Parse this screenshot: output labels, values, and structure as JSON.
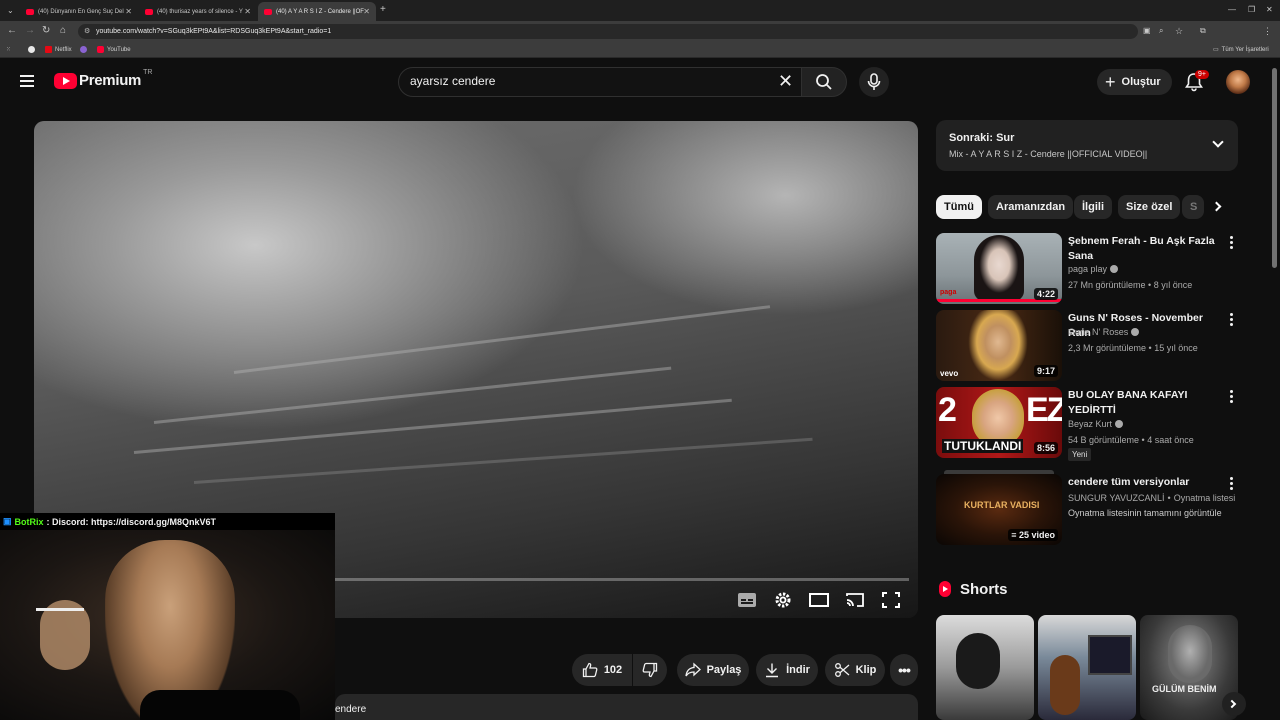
{
  "browser": {
    "tabs": [
      {
        "title": "(40) Dünyanın En Genç Suç Del"
      },
      {
        "title": "(40) thurisaz years of silence - Y"
      },
      {
        "title": "(40) A Y A R S I Z - Cendere ||OF"
      }
    ],
    "url": "youtube.com/watch?v=SGuq3kEPt9A&list=RDSGuq3kEPt9A&start_radio=1",
    "bookmarks": [
      "Netflix",
      "YouTube"
    ],
    "all_bookmarks": "Tüm Yer İşaretleri"
  },
  "header": {
    "brand": "Premium",
    "region": "TR",
    "search_value": "ayarsız cendere",
    "create_label": "Oluştur",
    "notif_count": "9+"
  },
  "stream": {
    "bot_name": "BotRix",
    "bot_message": ": Discord: https://discord.gg/M8QnkV6T"
  },
  "actions": {
    "like_count": "102",
    "share": "Paylaş",
    "download": "İndir",
    "clip": "Klip"
  },
  "description": {
    "text": "endere"
  },
  "upnext": {
    "title": "Sonraki: Sur",
    "subtitle": "Mix - A Y A R S I Z - Cendere ||OFFICIAL VIDEO||"
  },
  "chips": [
    "Tümü",
    "Aramanızdan",
    "İlgili",
    "Size özel",
    "S"
  ],
  "recommendations": [
    {
      "title": "Şebnem Ferah - Bu Aşk Fazla Sana",
      "channel": "paga play",
      "views": "27 Mn görüntüleme",
      "age": "8 yıl önce",
      "duration": "4:22"
    },
    {
      "title": "Guns N' Roses - November Rain",
      "channel": "Guns N' Roses",
      "views": "2,3 Mr görüntüleme",
      "age": "15 yıl önce",
      "duration": "9:17"
    },
    {
      "title": "BU OLAY BANA KAFAYI YEDİRTTİ",
      "channel": "Beyaz Kurt",
      "views": "54 B görüntüleme",
      "age": "4 saat önce",
      "duration": "8:56",
      "badge": "Yeni"
    },
    {
      "title": "cendere tüm versiyonlar",
      "channel": "SUNGUR YAVUZCANLİ",
      "channel_suffix": "Oynatma listesi",
      "meta": "Oynatma listesinin tamamını görüntüle",
      "duration": "25 video"
    }
  ],
  "thumb_text": {
    "paga": "paga",
    "vevo": "vevo",
    "tutuklandi": "TUTUKLANDI",
    "kurtlar": "KURTLAR VADISI",
    "gulum": "GÜLÜM BENİM"
  },
  "shorts": {
    "title": "Shorts"
  },
  "colors": {
    "brand_red": "#ff0033",
    "background": "#0f0f0f",
    "surface": "#272727"
  }
}
